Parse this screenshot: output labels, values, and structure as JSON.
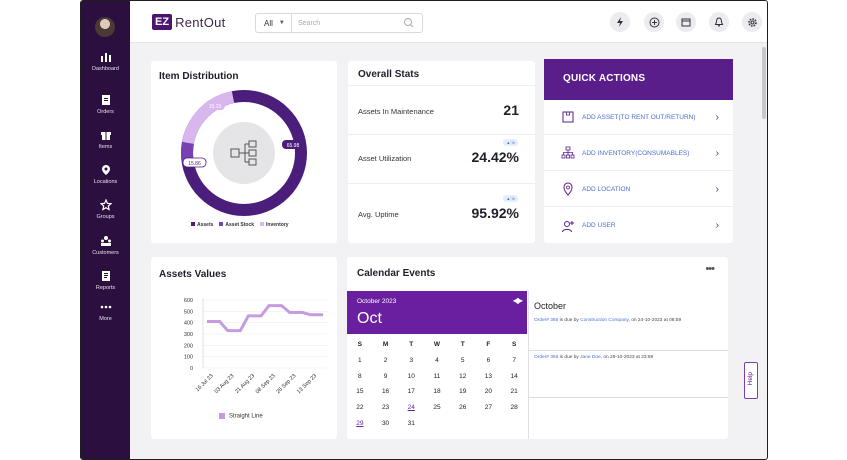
{
  "brand": {
    "ez": "EZ",
    "name": "RentOut"
  },
  "search": {
    "scope": "All",
    "placeholder": "Search"
  },
  "nav": [
    {
      "label": "Dashboard",
      "icon": "dashboard-icon"
    },
    {
      "label": "Orders",
      "icon": "orders-icon"
    },
    {
      "label": "Items",
      "icon": "items-icon"
    },
    {
      "label": "Locations",
      "icon": "location-pin-icon"
    },
    {
      "label": "Groups",
      "icon": "star-icon"
    },
    {
      "label": "Customers",
      "icon": "customers-icon"
    },
    {
      "label": "Reports",
      "icon": "reports-icon"
    },
    {
      "label": "More",
      "icon": "more-dots-icon"
    }
  ],
  "topbar_icons": [
    "bolt-icon",
    "plus-circle-icon",
    "calendar-icon",
    "bell-icon",
    "gear-icon",
    "help-icon"
  ],
  "item_distribution": {
    "title": "Item Distribution",
    "labels": {
      "light": "15.15",
      "mid": "15.86",
      "dark": "65.98"
    },
    "legend": [
      "Assets",
      "Asset Stock",
      "Inventory"
    ]
  },
  "overall_stats": {
    "title": "Overall Stats",
    "rows": [
      {
        "label": "Assets In Maintenance",
        "value": "21"
      },
      {
        "label": "Asset Utilization",
        "value": "24.42%",
        "badge": "▲ %"
      },
      {
        "label": "Avg. Uptime",
        "value": "95.92%",
        "badge": "▲ %"
      }
    ]
  },
  "quick_actions": {
    "title": "QUICK ACTIONS",
    "items": [
      {
        "label": "ADD ASSET(TO RENT OUT/RETURN)",
        "icon": "box-icon"
      },
      {
        "label": "ADD INVENTORY(CONSUMABLES)",
        "icon": "hierarchy-icon"
      },
      {
        "label": "ADD LOCATION",
        "icon": "location-pin-icon"
      },
      {
        "label": "ADD  USER",
        "icon": "add-user-icon"
      }
    ]
  },
  "assets_values": {
    "title": "Assets Values",
    "legend": "Straight Line"
  },
  "chart_data": {
    "type": "line",
    "title": "Assets Values",
    "x": [
      "16 Jul 23",
      "03 Aug 23",
      "21 Aug 23",
      "08 Sep 23",
      "26 Sep 23",
      "13 Sep 23"
    ],
    "ylim": [
      0,
      600
    ],
    "yticks": [
      0,
      100,
      200,
      300,
      400,
      500,
      600
    ],
    "series": [
      {
        "name": "Straight Line",
        "values": [
          410,
          330,
          460,
          550,
          490,
          470
        ],
        "color": "#c79be0"
      }
    ]
  },
  "calendar": {
    "title": "Calendar Events",
    "month_year": "October 2023",
    "month_short": "Oct",
    "weekdays": [
      "S",
      "M",
      "T",
      "W",
      "T",
      "F",
      "S"
    ],
    "days": [
      "1",
      "2",
      "3",
      "4",
      "5",
      "6",
      "7",
      "8",
      "9",
      "10",
      "11",
      "12",
      "13",
      "14",
      "15",
      "16",
      "17",
      "18",
      "19",
      "20",
      "21",
      "22",
      "23",
      "24",
      "25",
      "26",
      "27",
      "28",
      "29",
      "30",
      "31"
    ],
    "marked": [
      "24",
      "29"
    ],
    "events_heading": "October",
    "events": [
      {
        "order": "Order# 365",
        "mid": " is due by ",
        "who": "Construction Company",
        "tail": ", on 24-10-2023 at 08:59"
      },
      {
        "order": "Order# 366",
        "mid": " is due by ",
        "who": "Jane Doe",
        "tail": ", on 29-10-2023 at 23:59"
      }
    ]
  },
  "help": "Help",
  "colors": {
    "sidebar": "#2b0f3f",
    "accent": "#5a1e8a",
    "link": "#4a6fd0"
  }
}
